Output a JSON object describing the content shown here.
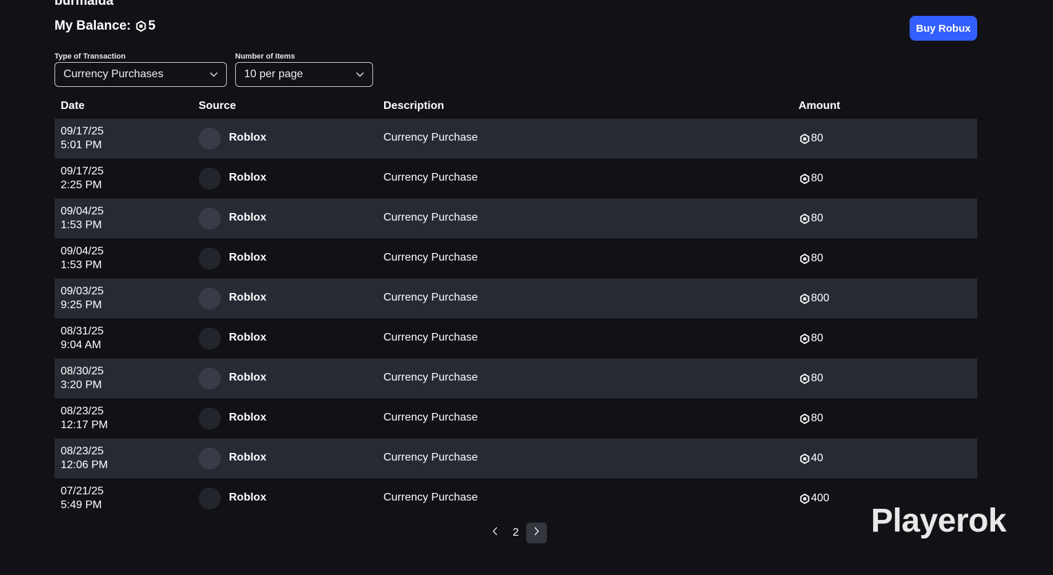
{
  "header": {
    "username": "burmalda",
    "balance_label": "My Balance:",
    "balance_value": "5",
    "buy_button_label": "Buy Robux"
  },
  "filters": {
    "type": {
      "label": "Type of Transaction",
      "value": "Currency Purchases"
    },
    "count": {
      "label": "Number of Items",
      "value": "10 per page"
    }
  },
  "table": {
    "columns": [
      "Date",
      "Source",
      "Description",
      "Amount"
    ],
    "rows": [
      {
        "date": "09/17/25",
        "time": "5:01 PM",
        "source": "Roblox",
        "description": "Currency Purchase",
        "amount": "80"
      },
      {
        "date": "09/17/25",
        "time": "2:25 PM",
        "source": "Roblox",
        "description": "Currency Purchase",
        "amount": "80"
      },
      {
        "date": "09/04/25",
        "time": "1:53 PM",
        "source": "Roblox",
        "description": "Currency Purchase",
        "amount": "80"
      },
      {
        "date": "09/04/25",
        "time": "1:53 PM",
        "source": "Roblox",
        "description": "Currency Purchase",
        "amount": "80"
      },
      {
        "date": "09/03/25",
        "time": "9:25 PM",
        "source": "Roblox",
        "description": "Currency Purchase",
        "amount": "800"
      },
      {
        "date": "08/31/25",
        "time": "9:04 AM",
        "source": "Roblox",
        "description": "Currency Purchase",
        "amount": "80"
      },
      {
        "date": "08/30/25",
        "time": "3:20 PM",
        "source": "Roblox",
        "description": "Currency Purchase",
        "amount": "80"
      },
      {
        "date": "08/23/25",
        "time": "12:17 PM",
        "source": "Roblox",
        "description": "Currency Purchase",
        "amount": "80"
      },
      {
        "date": "08/23/25",
        "time": "12:06 PM",
        "source": "Roblox",
        "description": "Currency Purchase",
        "amount": "40"
      },
      {
        "date": "07/21/25",
        "time": "5:49 PM",
        "source": "Roblox",
        "description": "Currency Purchase",
        "amount": "400"
      }
    ]
  },
  "pagination": {
    "current_page": "2"
  },
  "watermark": {
    "text": "Playerok"
  },
  "icons": {
    "currency": "robux-icon",
    "dropdown": "chevron-down-icon",
    "prev": "chevron-left-icon",
    "next": "chevron-right-icon"
  },
  "colors": {
    "accent": "#335fff",
    "background": "#111116",
    "row_shaded": "#272a33"
  }
}
